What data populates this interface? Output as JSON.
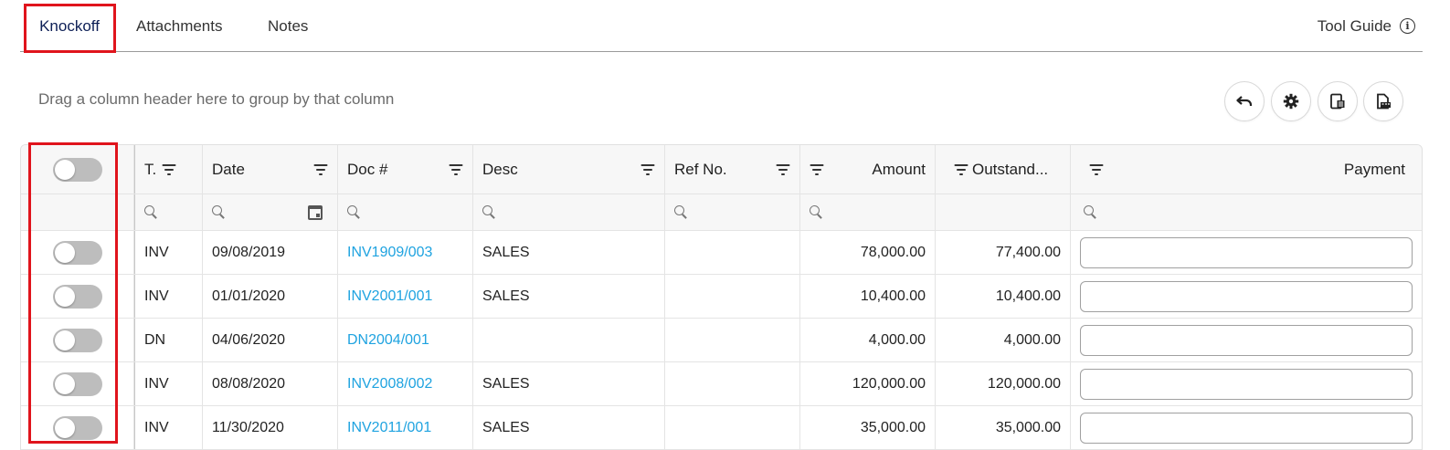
{
  "tabs": [
    {
      "label": "Knockoff",
      "active": true
    },
    {
      "label": "Attachments",
      "active": false
    },
    {
      "label": "Notes",
      "active": false
    }
  ],
  "tool_guide": {
    "label": "Tool Guide",
    "icon": "info-icon"
  },
  "group_hint": "Drag a column header here to group by that column",
  "toolbar": [
    {
      "icon": "undo-icon"
    },
    {
      "icon": "gear-icon"
    },
    {
      "icon": "excel-export-icon"
    },
    {
      "icon": "pdf-export-icon"
    }
  ],
  "columns": {
    "type": "T.",
    "date": "Date",
    "doc": "Doc #",
    "desc": "Desc",
    "ref": "Ref No.",
    "amount": "Amount",
    "outstanding": "Outstand...",
    "payment": "Payment"
  },
  "rows": [
    {
      "type": "INV",
      "date": "09/08/2019",
      "doc": "INV1909/003",
      "desc": "SALES",
      "ref": "",
      "amount": "78,000.00",
      "outstanding": "77,400.00",
      "payment": ""
    },
    {
      "type": "INV",
      "date": "01/01/2020",
      "doc": "INV2001/001",
      "desc": "SALES",
      "ref": "",
      "amount": "10,400.00",
      "outstanding": "10,400.00",
      "payment": ""
    },
    {
      "type": "DN",
      "date": "04/06/2020",
      "doc": "DN2004/001",
      "desc": "",
      "ref": "",
      "amount": "4,000.00",
      "outstanding": "4,000.00",
      "payment": ""
    },
    {
      "type": "INV",
      "date": "08/08/2020",
      "doc": "INV2008/002",
      "desc": "SALES",
      "ref": "",
      "amount": "120,000.00",
      "outstanding": "120,000.00",
      "payment": ""
    },
    {
      "type": "INV",
      "date": "11/30/2020",
      "doc": "INV2011/001",
      "desc": "SALES",
      "ref": "",
      "amount": "35,000.00",
      "outstanding": "35,000.00",
      "payment": ""
    }
  ],
  "colors": {
    "accent": "#0d1f56",
    "link": "#1fa3e0",
    "highlight": "#e0141c",
    "toggle_off": "#bdbdbd"
  }
}
